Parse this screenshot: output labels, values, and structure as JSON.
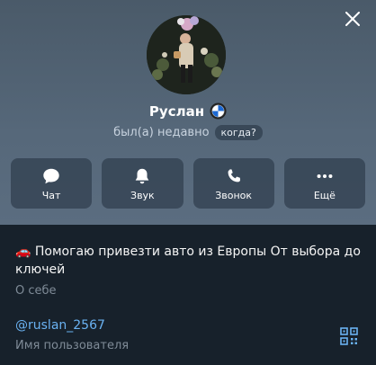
{
  "profile": {
    "name": "Руслан",
    "badge_icon": "bmw-logo-icon",
    "status": "был(а) недавно",
    "when_label": "когда?"
  },
  "actions": [
    {
      "label": "Чат",
      "icon": "chat-bubble-icon"
    },
    {
      "label": "Звук",
      "icon": "bell-icon"
    },
    {
      "label": "Звонок",
      "icon": "phone-icon"
    },
    {
      "label": "Ещё",
      "icon": "more-dots-icon"
    }
  ],
  "bio": {
    "text": "🚗 Помогаю привезти авто из Европы От выбора до ключей",
    "label": "О себе"
  },
  "username": {
    "value": "@ruslan_2567",
    "label": "Имя пользователя"
  },
  "colors": {
    "header_bg": "#56687a",
    "body_bg": "#17212b",
    "link": "#6ab2f2",
    "secondary_text": "#7f8b97"
  }
}
